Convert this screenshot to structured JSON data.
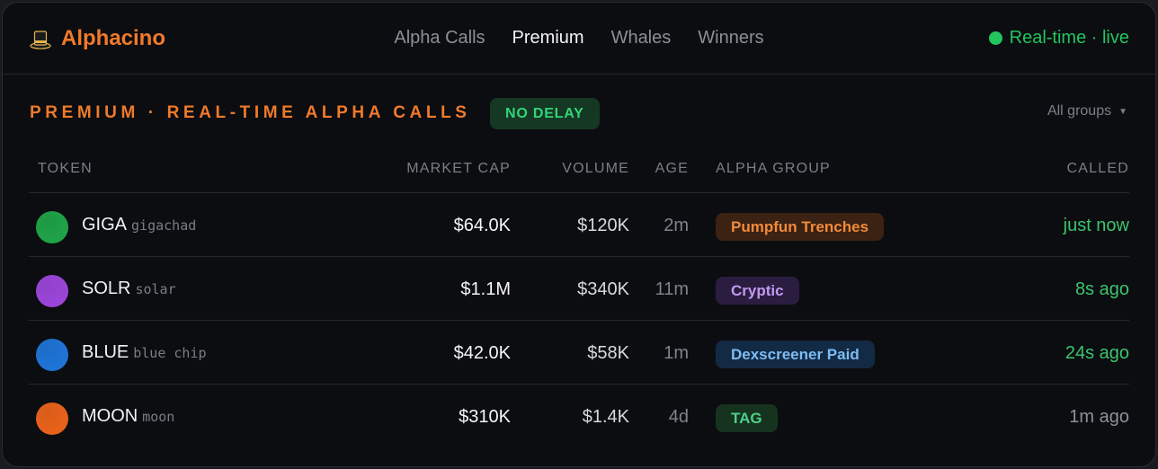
{
  "app": {
    "brand_icon": "top-hat-icon",
    "brand_name": "Alphacino"
  },
  "nav": {
    "items": [
      {
        "label": "Alpha Calls",
        "active": false
      },
      {
        "label": "Premium",
        "active": true
      },
      {
        "label": "Whales",
        "active": false
      },
      {
        "label": "Winners",
        "active": false
      }
    ]
  },
  "status": {
    "text": "Real-time · live",
    "color": "#22c55e"
  },
  "section": {
    "title": "PREMIUM · REAL-TIME ALPHA CALLS",
    "badge": "NO DELAY",
    "filter_label": "All groups",
    "filter_icon": "caret-down-icon"
  },
  "table": {
    "headers": {
      "token": "TOKEN",
      "market_cap": "MARKET CAP",
      "volume": "VOLUME",
      "age": "AGE",
      "alpha_group": "ALPHA GROUP",
      "called": "CALLED"
    },
    "rows": [
      {
        "symbol": "GIGA",
        "name": "gigachad",
        "avatar_color": "#1fa347",
        "market_cap": "$64.0K",
        "volume": "$120K",
        "age": "2m",
        "group": "Pumpfun Trenches",
        "group_bg": "#3b2212",
        "group_fg": "#f28a3b",
        "called": "just now",
        "called_color": "#3bc46e"
      },
      {
        "symbol": "SOLR",
        "name": "solar",
        "avatar_color": "#9b45d9",
        "market_cap": "$1.1M",
        "volume": "$340K",
        "age": "11m",
        "group": "Cryptic",
        "group_bg": "#2a1d40",
        "group_fg": "#c29af0",
        "called": "8s ago",
        "called_color": "#3bc46e"
      },
      {
        "symbol": "BLUE",
        "name": "blue chip",
        "avatar_color": "#1f74d6",
        "market_cap": "$42.0K",
        "volume": "$58K",
        "age": "1m",
        "group": "Dexscreener Paid",
        "group_bg": "#132a45",
        "group_fg": "#7dbcf2",
        "called": "24s ago",
        "called_color": "#3bc46e"
      },
      {
        "symbol": "MOON",
        "name": "moon",
        "avatar_color": "#e8621a",
        "market_cap": "$310K",
        "volume": "$1.4K",
        "age": "4d",
        "group": "TAG",
        "group_bg": "#16331f",
        "group_fg": "#4cd08a",
        "called": "1m ago",
        "called_color": "#8e9198"
      }
    ]
  }
}
